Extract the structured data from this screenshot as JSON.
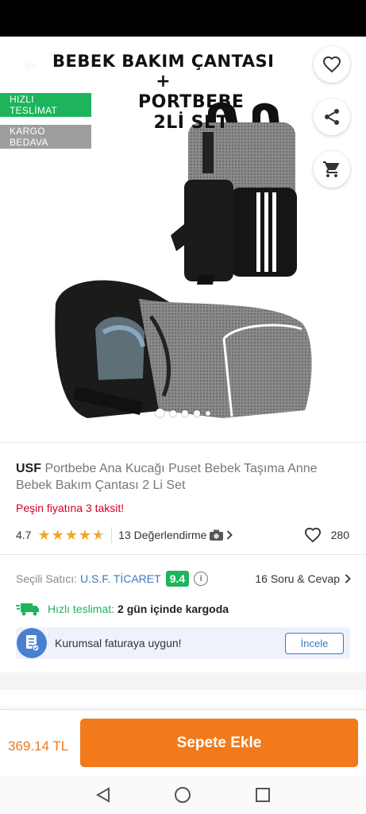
{
  "hero": {
    "title_line1": "BEBEK BAKIM ÇANTASI",
    "title_plus": "+",
    "title_line2": "PORTBEBE",
    "title_line3": "2Lİ SET",
    "badges": {
      "fast": "HIZLI TESLİMAT",
      "cargo": "KARGO BEDAVA"
    },
    "icons": {
      "back": "back-arrow-icon",
      "favorite": "heart-icon",
      "share": "share-icon",
      "cart": "cart-icon"
    },
    "image_dots": 5,
    "active_dot": 1
  },
  "product": {
    "brand": "USF",
    "name": "Portbebe Ana Kucağı Puset Bebek Taşıma Anne Bebek Bakım Çantası 2 Li Set",
    "installment": "Peşin fiyatına 3 taksit!",
    "rating": "4.7",
    "rating_value": 4.7,
    "reviews": "13 Değerlendirme",
    "favorites": "280"
  },
  "seller": {
    "label": "Seçili Satıcı:",
    "name": "U.S.F. TİCARET",
    "score": "9.4",
    "qa": "16 Soru & Cevap"
  },
  "delivery": {
    "label": "Hızlı teslimat:",
    "value": "2 gün içinde kargoda"
  },
  "corporate": {
    "text": "Kurumsal faturaya uygun!",
    "button": "İncele"
  },
  "bottom": {
    "price": "369.14 TL",
    "add_to_cart": "Sepete Ekle"
  },
  "colors": {
    "accent": "#f27a1a",
    "green": "#1db45c",
    "link": "#3b78c3",
    "red": "#d0022c"
  }
}
